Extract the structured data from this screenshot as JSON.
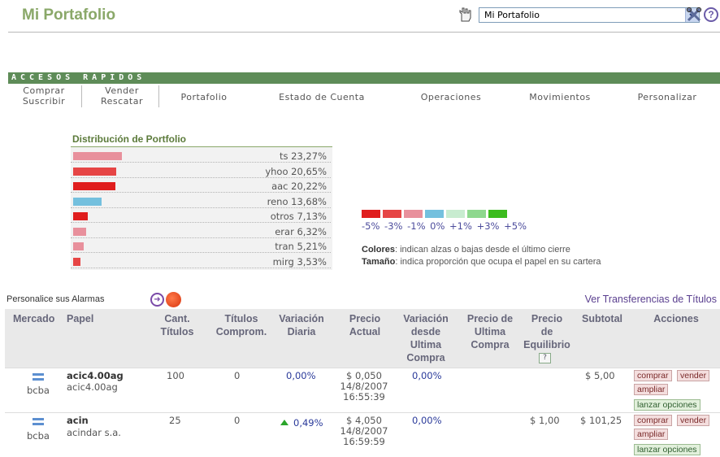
{
  "header": {
    "title": "Mi Portafolio",
    "select_value": "Mi Portafolio"
  },
  "quick_access": {
    "title": "ACCESOS RAPIDOS",
    "items": [
      "Comprar\nSuscribir",
      "Vender\nRescatar",
      "Portafolio",
      "Estado de Cuenta",
      "Operaciones",
      "Movimientos",
      "Personalizar"
    ]
  },
  "distribution": {
    "title": "Distribución de Portfolio",
    "rows": [
      {
        "label": "ts 23,27%",
        "share": 23.27,
        "color": "#e8909c"
      },
      {
        "label": "yhoo 20,65%",
        "share": 20.65,
        "color": "#e64545"
      },
      {
        "label": "aac 20,22%",
        "share": 20.22,
        "color": "#e01e1e"
      },
      {
        "label": "reno 13,68%",
        "share": 13.68,
        "color": "#74c0de"
      },
      {
        "label": "otros 7,13%",
        "share": 7.13,
        "color": "#e01e1e"
      },
      {
        "label": "erar 6,32%",
        "share": 6.32,
        "color": "#e8909c"
      },
      {
        "label": "tran 5,21%",
        "share": 5.21,
        "color": "#e8909c"
      },
      {
        "label": "mirg 3,53%",
        "share": 3.53,
        "color": "#e64545"
      }
    ]
  },
  "legend": {
    "labels": "-5% -3% -1% 0% +1% +3% +5%",
    "colors": [
      "#e01e1e",
      "#e64545",
      "#e8909c",
      "#74c0de",
      "#c8ecd0",
      "#8ed88e",
      "#3cbc1e"
    ],
    "note1_bold": "Colores",
    "note1": ": indican alzas o bajas desde el último cierre",
    "note2_bold": "Tamaño",
    "note2": ": indica proporción que ocupa el papel en su cartera"
  },
  "alarms": {
    "label": "Personalice sus Alarmas",
    "transfers_link": "Ver Transferencias de Títulos"
  },
  "table": {
    "headers": {
      "mercado": "Mercado",
      "papel": "Papel",
      "cant": "Cant.\nTítulos",
      "comprom": "Títulos\nComprom.",
      "variacion": "Variación\nDiaria",
      "precio": "Precio\nActual",
      "var_ultima": "Variación\ndesde\nUltima\nCompra",
      "precio_ultima": "Precio de\nUltima\nCompra",
      "equilibrio": "Precio\nde\nEquilibrio",
      "equilibrio_help": "?",
      "subtotal": "Subtotal",
      "acciones": "Acciones"
    },
    "rows": [
      {
        "mercado": "bcba",
        "papel": "acic4.00ag",
        "papel_desc": "acic4.00ag",
        "cant": "100",
        "comprom": "0",
        "variacion": "0,00%",
        "variacion_up": false,
        "precio": "$ 0,050",
        "fecha": "14/8/2007",
        "hora": "16:55:39",
        "var_ultima": "0,00%",
        "precio_ultima": "",
        "equilibrio": "",
        "subtotal": "$ 5,00"
      },
      {
        "mercado": "bcba",
        "papel": "acin",
        "papel_desc": "acindar s.a.",
        "cant": "25",
        "comprom": "0",
        "variacion": "0,49%",
        "variacion_up": true,
        "precio": "$ 4,050",
        "fecha": "14/8/2007",
        "hora": "16:59:59",
        "var_ultima": "0,00%",
        "precio_ultima": "",
        "equilibrio": "$ 1,00",
        "subtotal": "$ 101,25"
      }
    ],
    "actions": {
      "comprar": "comprar",
      "vender": "vender",
      "ampliar": "ampliar",
      "opciones": "lanzar opciones"
    }
  }
}
